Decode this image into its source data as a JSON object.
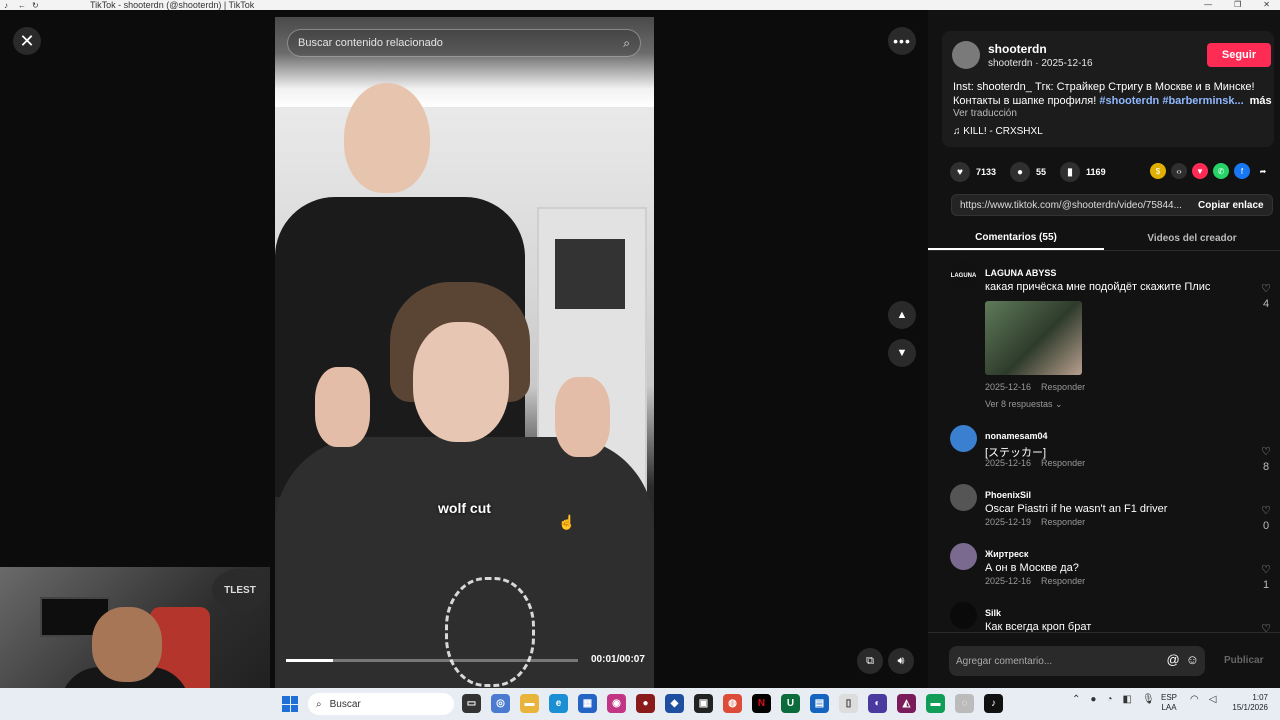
{
  "window": {
    "title": "TikTok - shooterdn (@shooterdn) | TikTok"
  },
  "video": {
    "search_placeholder": "Buscar contenido relacionado",
    "caption": "wolf cut",
    "time": "00:01/00:07",
    "progress": 0.16
  },
  "webcam": {
    "sign": "TLEST"
  },
  "author": {
    "name": "shooterdn",
    "sub": "shooterdn · 2025-12-16",
    "follow_label": "Seguir"
  },
  "description": {
    "text": "Inst: shooterdn_ Тгк: Страйкер Стригу в Москве и в Минске! Контакты в шапке профиля! ",
    "tag1": "#shooterdn",
    "tag2": "#barberminsk...",
    "more": "más",
    "translate": "Ver traducción",
    "music": "KILL! - CRXSHXL"
  },
  "stats": {
    "likes": "7133",
    "comments": "55",
    "saves": "1169"
  },
  "link": {
    "url": "https://www.tiktok.com/@shooterdn/video/75844...",
    "copy_label": "Copiar enlace"
  },
  "tabs": {
    "comments": "Comentarios (55)",
    "creator_videos": "Videos del creador"
  },
  "comments": [
    {
      "user": "LAGUNA ABYSS",
      "avatar_text": "LAGUNA",
      "text": "какая причёска мне подойдёт скажите Плис",
      "date": "2025-12-16",
      "reply": "Responder",
      "likes": "4",
      "replies": "Ver 8 respuestas ⌄"
    },
    {
      "user": "nonamesam04",
      "text": "[ステッカー]",
      "date": "2025-12-16",
      "reply": "Responder",
      "likes": "8"
    },
    {
      "user": "PhoenixSil",
      "text": "Oscar Piastri if he wasn't an F1 driver",
      "date": "2025-12-19",
      "reply": "Responder",
      "likes": "0"
    },
    {
      "user": "Жиртреск",
      "text": "А он в Москве да?",
      "date": "2025-12-16",
      "reply": "Responder",
      "likes": "1"
    },
    {
      "user": "Silk",
      "text": "Как всегда кроп брат",
      "date": "",
      "reply": "",
      "likes": ""
    }
  ],
  "add_comment": {
    "placeholder": "Agregar comentario...",
    "publish": "Publicar"
  },
  "taskbar": {
    "search": "Buscar",
    "lang_top": "ESP",
    "lang_bottom": "LAA",
    "time": "1:07",
    "date": "15/1/2026"
  },
  "colors": {
    "accent": "#fe2c55",
    "tag": "#8fb8ff"
  }
}
